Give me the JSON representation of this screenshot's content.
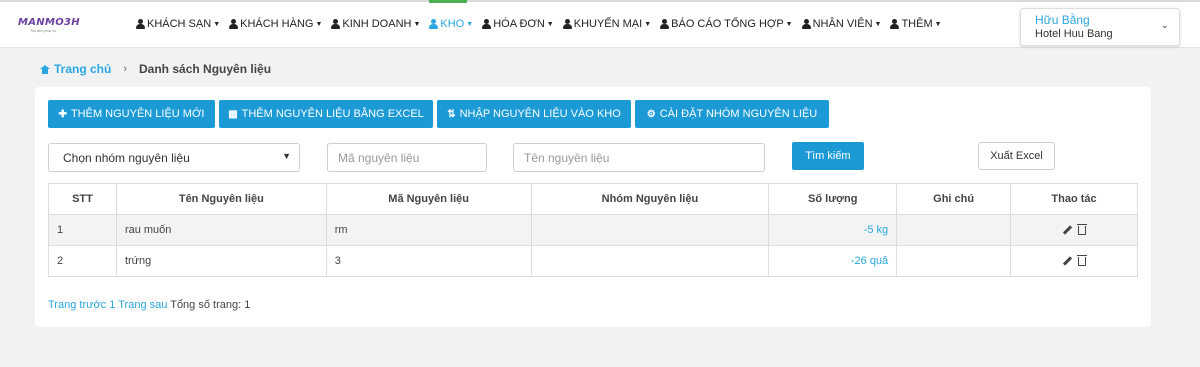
{
  "header": {
    "logo": "MANMO3H",
    "logo_tagline": "Tận tâm phục vụ",
    "menu": [
      {
        "label": "KHÁCH SẠN",
        "active": false
      },
      {
        "label": "KHÁCH HÀNG",
        "active": false
      },
      {
        "label": "KINH DOANH",
        "active": false
      },
      {
        "label": "KHO",
        "active": true
      },
      {
        "label": "HÓA ĐƠN",
        "active": false
      },
      {
        "label": "KHUYẾN MẠI",
        "active": false
      },
      {
        "label": "BÁO CÁO TỔNG HỢP",
        "active": false
      },
      {
        "label": "NHÂN VIÊN",
        "active": false
      },
      {
        "label": "THÊM",
        "active": false
      }
    ],
    "account": {
      "name": "Hữu Bằng",
      "hotel": "Hotel Huu Bang"
    }
  },
  "breadcrumb": {
    "home": "Trang chủ",
    "current": "Danh sách Nguyên liệu"
  },
  "toolbar": {
    "add_label": "THÊM NGUYÊN LIỆU MỚI",
    "excel_add_label": "THÊM NGUYÊN LIỆU BẰNG EXCEL",
    "import_label": "NHẬP NGUYÊN LIỆU VÀO KHO",
    "settings_label": "CÀI ĐẶT NHÓM NGUYÊN LIỆU"
  },
  "filters": {
    "group_select": "Chọn nhóm nguyên liệu",
    "code_placeholder": "Mã nguyên liệu",
    "name_placeholder": "Tên nguyên liệu",
    "search_label": "Tìm kiếm",
    "export_label": "Xuất Excel"
  },
  "table": {
    "headers": [
      "STT",
      "Tên Nguyên liệu",
      "Mã Nguyên liệu",
      "Nhóm Nguyên liệu",
      "Số lượng",
      "Ghi chú",
      "Thao tác"
    ],
    "rows": [
      {
        "stt": "1",
        "name": "rau muốn",
        "code": "rm",
        "group": "",
        "qty": "-5 kg",
        "note": ""
      },
      {
        "stt": "2",
        "name": "trứng",
        "code": "3",
        "group": "",
        "qty": "-26 quả",
        "note": ""
      }
    ]
  },
  "pager": {
    "prev": "Trang trước",
    "page": "1",
    "next": "Trang sau",
    "total": "Tổng số trang: 1"
  },
  "colors": {
    "accent": "#1b9ad6",
    "link": "#2aa7e0",
    "active_bar": "#4caf50",
    "brand": "#6b3fa0"
  }
}
